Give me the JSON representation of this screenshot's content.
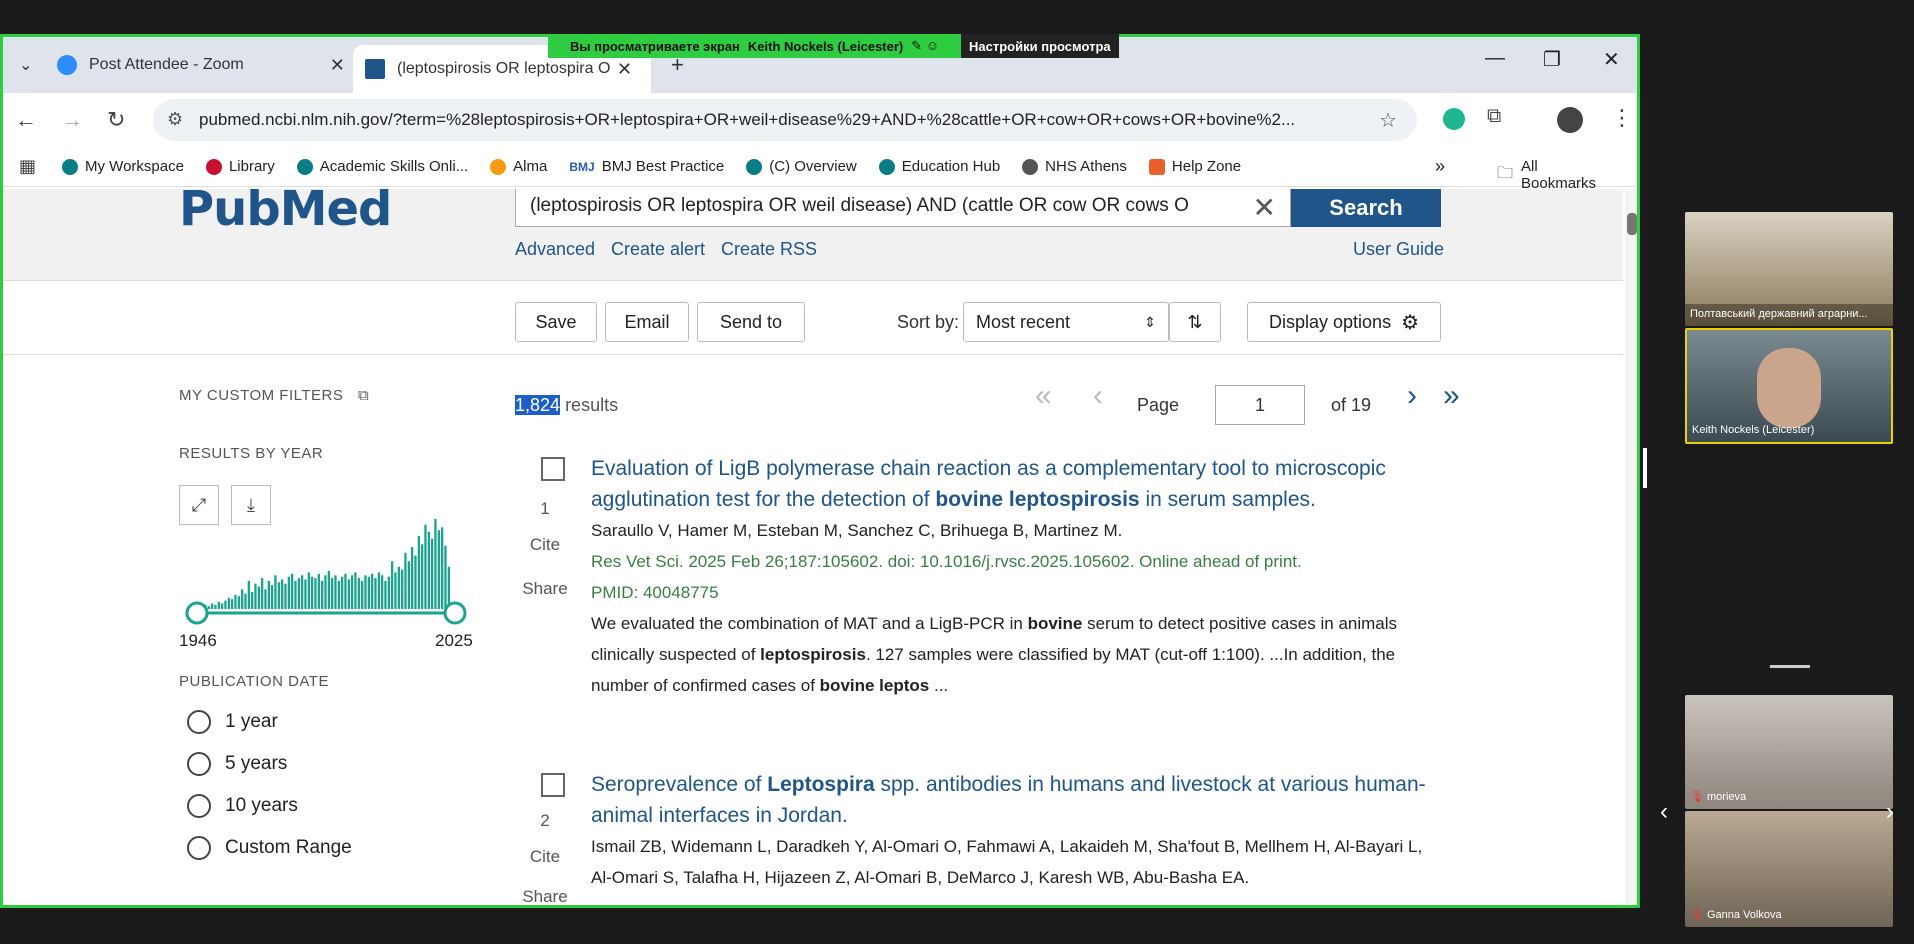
{
  "zoom_banner": {
    "viewing_text": "Вы просматриваете экран",
    "presenter": "Keith Nockels (Leicester)",
    "view_options": "Настройки просмотра"
  },
  "browser": {
    "tabs": [
      {
        "label": "Post Attendee - Zoom"
      },
      {
        "label": "(leptospirosis OR leptospira OR"
      }
    ],
    "url": "pubmed.ncbi.nlm.nih.gov/?term=%28leptospirosis+OR+leptospira+OR+weil+disease%29+AND+%28cattle+OR+cow+OR+cows+OR+bovine%2...",
    "bookmarks": [
      "My Workspace",
      "Library",
      "Academic Skills Onli...",
      "Alma",
      "BMJ Best Practice",
      "(C) Overview",
      "Education Hub",
      "NHS Athens",
      "Help Zone"
    ],
    "all_bookmarks": "All Bookmarks"
  },
  "pubmed": {
    "logo": "PubMed",
    "query": "(leptospirosis OR leptospira OR weil disease) AND (cattle OR cow OR cows O",
    "search_button": "Search",
    "links": {
      "advanced": "Advanced",
      "create_alert": "Create alert",
      "create_rss": "Create RSS",
      "user_guide": "User Guide"
    },
    "actions": {
      "save": "Save",
      "email": "Email",
      "send_to": "Send to",
      "sort_by": "Sort by:",
      "sort_value": "Most recent",
      "display_options": "Display options"
    },
    "filters": {
      "custom": "MY CUSTOM FILTERS",
      "by_year": "RESULTS BY YEAR",
      "year_start": "1946",
      "year_end": "2025",
      "pub_date": "PUBLICATION DATE",
      "options": [
        "1 year",
        "5 years",
        "10 years",
        "Custom Range"
      ]
    },
    "results": {
      "count": "1,824",
      "count_suffix": "results",
      "page_label": "Page",
      "page": "1",
      "of_pages": "of 19"
    },
    "articles": [
      {
        "num": "1",
        "cite": "Cite",
        "share": "Share",
        "title_a": "Evaluation of LigB polymerase chain reaction as a complementary tool to microscopic agglutination test for the detection of ",
        "title_b": "bovine leptospirosis",
        "title_c": " in serum samples.",
        "authors": "Saraullo V, Hamer M, Esteban M, Sanchez C, Brihuega B, Martinez M.",
        "citation": "Res Vet Sci. 2025 Feb 26;187:105602. doi: 10.1016/j.rvsc.2025.105602. Online ahead of print.",
        "pmid": "PMID: 40048775",
        "snippet_1": "We evaluated the combination of MAT and a LigB-PCR in ",
        "snippet_b1": "bovine",
        "snippet_2": " serum to detect positive cases in animals clinically suspected of ",
        "snippet_b2": "leptospirosis",
        "snippet_3": ". 127 samples were classified by MAT (cut-off 1:100). ...In addition, the number of confirmed cases of ",
        "snippet_b3": "bovine leptos",
        "snippet_4": " ..."
      },
      {
        "num": "2",
        "cite": "Cite",
        "share": "Share",
        "title_a": "Seroprevalence of ",
        "title_b": "Leptospira",
        "title_c": " spp. antibodies in humans and livestock at various human-animal interfaces in Jordan.",
        "authors": "Ismail ZB, Widemann L, Daradkeh Y, Al-Omari O, Fahmawi A, Lakaideh M, Sha'fout B, Mellhem H, Al-Bayari L, Al-Omari S, Talafha H, Hijazeen Z, Al-Omari B, DeMarco J, Karesh WB, Abu-Basha EA."
      }
    ]
  },
  "histogram": {
    "values": [
      2,
      3,
      2,
      4,
      3,
      5,
      4,
      6,
      8,
      7,
      10,
      9,
      14,
      11,
      20,
      12,
      18,
      16,
      22,
      14,
      20,
      17,
      24,
      19,
      21,
      18,
      23,
      25,
      20,
      22,
      24,
      21,
      26,
      23,
      22,
      25,
      20,
      24,
      27,
      22,
      24,
      20,
      23,
      25,
      21,
      24,
      26,
      22,
      20,
      24,
      23,
      25,
      22,
      26,
      24,
      20,
      23,
      34,
      26,
      30,
      28,
      40,
      34,
      44,
      38,
      52,
      46,
      60,
      55,
      50,
      64,
      56,
      58,
      45,
      30
    ]
  },
  "participants": [
    {
      "name": "Полтавський державний аграрни..."
    },
    {
      "name": "Keith Nockels (Leicester)"
    },
    {
      "name": "morieva"
    },
    {
      "name": "Ganna Volkova"
    }
  ]
}
